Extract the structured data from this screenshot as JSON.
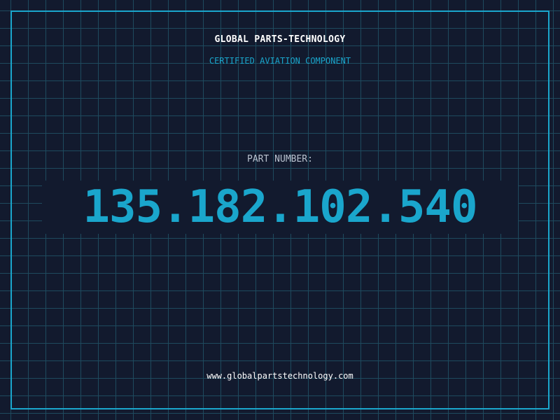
{
  "brand": {
    "name": "GLOBAL PARTS-TECHNOLOGY",
    "tagline": "CERTIFIED AVIATION COMPONENT"
  },
  "part": {
    "label": "PART NUMBER:",
    "number": "135.182.102.540"
  },
  "footer": {
    "website": "www.globalpartstechnology.com"
  },
  "colors": {
    "background": "#121a2e",
    "grid": "#1e4a5e",
    "accent": "#1aa6cc",
    "text": "#ffffff",
    "muted": "#b9c2cf"
  }
}
